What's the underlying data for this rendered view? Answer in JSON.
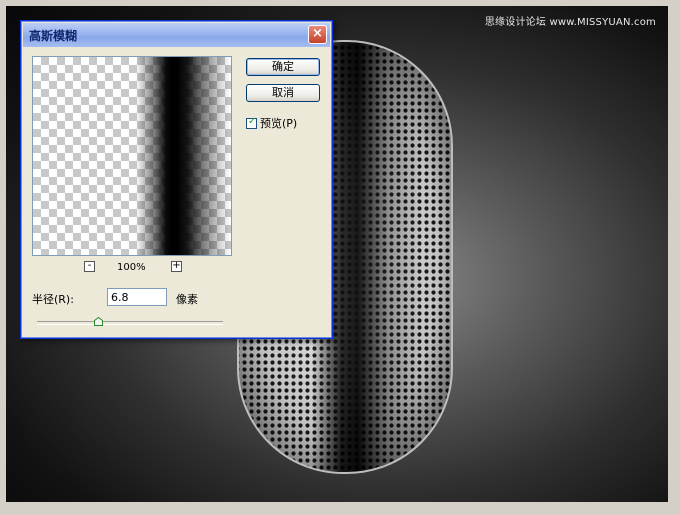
{
  "watermark": "思缘设计论坛 www.MISSYUAN.com",
  "dialog": {
    "title": "高斯模糊",
    "close_label": "×",
    "ok_label": "确定",
    "cancel_label": "取消",
    "preview_label": "预览(P)",
    "preview_checked": true,
    "zoom_out_label": "-",
    "zoom_in_label": "+",
    "zoom_level": "100%",
    "radius_label": "半径(R):",
    "radius_value": "6.8",
    "unit_label": "像素",
    "slider_fraction": 0.33
  },
  "icons": {
    "close": "close-icon",
    "check": "checkmark-icon",
    "slider": "slider-thumb-icon"
  },
  "colors": {
    "dialog_bg": "#ece9d8",
    "titlebar": "#9db6ee",
    "close": "#c5412b"
  }
}
